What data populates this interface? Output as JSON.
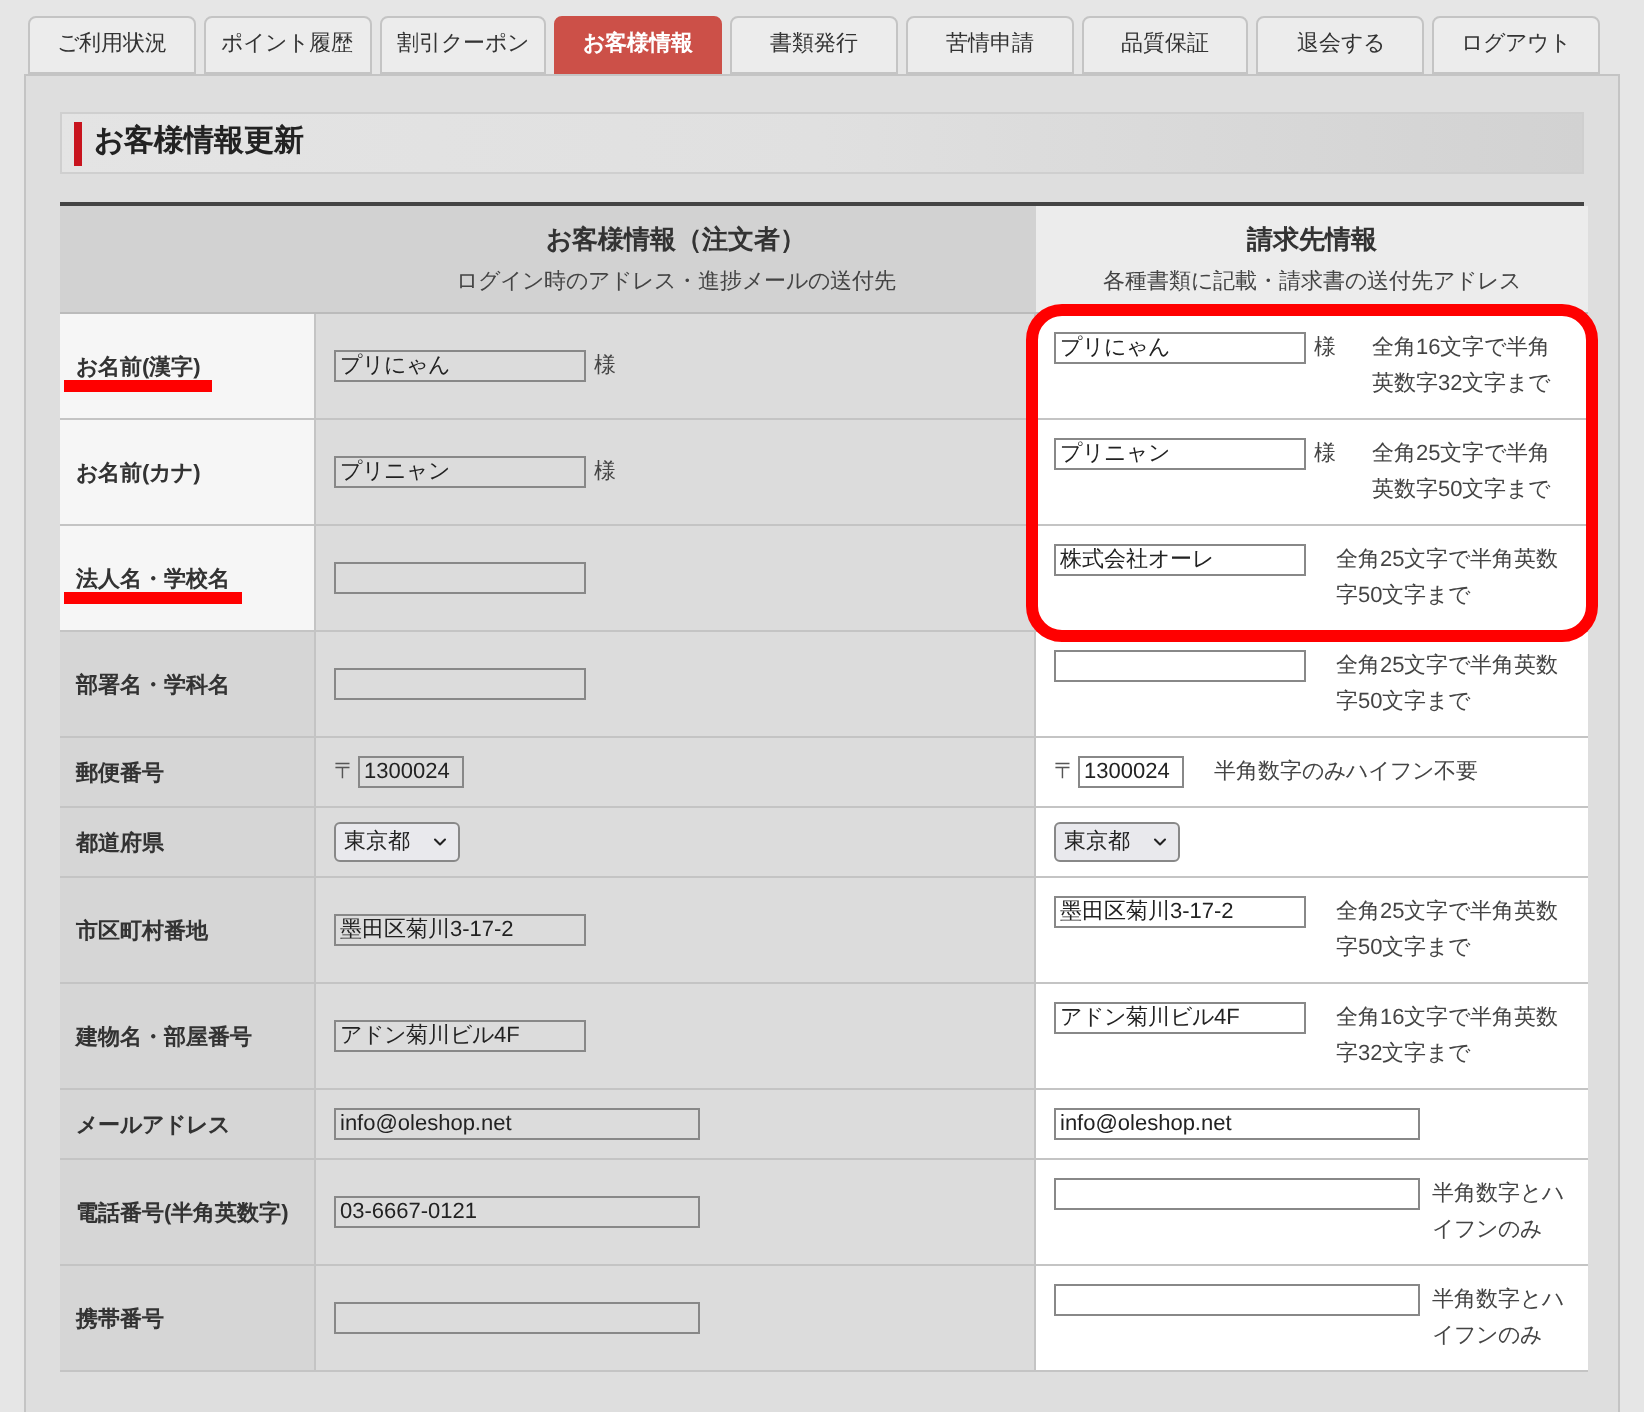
{
  "tabs": [
    {
      "label": "ご利用状況",
      "selected": false
    },
    {
      "label": "ポイント履歴",
      "selected": false
    },
    {
      "label": "割引クーポン",
      "selected": false
    },
    {
      "label": "お客様情報",
      "selected": true
    },
    {
      "label": "書類発行",
      "selected": false
    },
    {
      "label": "苦情申請",
      "selected": false
    },
    {
      "label": "品質保証",
      "selected": false
    },
    {
      "label": "退会する",
      "selected": false
    },
    {
      "label": "ログアウト",
      "selected": false
    }
  ],
  "section_title": "お客様情報更新",
  "header": {
    "customer_title": "お客様情報（注文者）",
    "customer_subtitle": "ログイン時のアドレス・進捗メールの送付先",
    "billing_title": "請求先情報",
    "billing_subtitle": "各種書類に記載・請求書の送付先アドレス"
  },
  "rows": [
    {
      "label": "お名前(漢字)",
      "underlined": true,
      "highlighted": true,
      "customer": {
        "kind": "field",
        "value": "プリにゃん",
        "suffix": "様"
      },
      "billing": {
        "kind": "field",
        "value": "プリにゃん",
        "suffix": "様",
        "note": "全角16文字で半角英数字32文字まで"
      }
    },
    {
      "label": "お名前(カナ)",
      "underlined": false,
      "highlighted": true,
      "customer": {
        "kind": "field",
        "value": "プリニャン",
        "suffix": "様"
      },
      "billing": {
        "kind": "field",
        "value": "プリニャン",
        "suffix": "様",
        "note": "全角25文字で半角英数字50文字まで"
      }
    },
    {
      "label": "法人名・学校名",
      "underlined": true,
      "highlighted": true,
      "customer": {
        "kind": "field"
      },
      "billing": {
        "kind": "field",
        "value": "株式会社オーレ",
        "note": "全角25文字で半角英数字50文字まで"
      }
    },
    {
      "label": "部署名・学科名",
      "underlined": false,
      "highlighted": false,
      "customer": {
        "kind": "field"
      },
      "billing": {
        "kind": "field",
        "note": "全角25文字で半角英数字50文字まで"
      }
    },
    {
      "label": "郵便番号",
      "underlined": false,
      "highlighted": false,
      "customer": {
        "kind": "postal",
        "prefix": "〒",
        "value": "1300024"
      },
      "billing": {
        "kind": "postal",
        "prefix": "〒",
        "value": "1300024",
        "note": "半角数字のみハイフン不要"
      }
    },
    {
      "label": "都道府県",
      "underlined": false,
      "highlighted": false,
      "customer": {
        "kind": "select",
        "value": "東京都"
      },
      "billing": {
        "kind": "select",
        "value": "東京都"
      }
    },
    {
      "label": "市区町村番地",
      "underlined": false,
      "highlighted": false,
      "customer": {
        "kind": "field",
        "value": "墨田区菊川3-17-2"
      },
      "billing": {
        "kind": "field",
        "value": "墨田区菊川3-17-2",
        "note": "全角25文字で半角英数字50文字まで"
      }
    },
    {
      "label": "建物名・部屋番号",
      "underlined": false,
      "highlighted": false,
      "customer": {
        "kind": "field",
        "value": "アドン菊川ビル4F"
      },
      "billing": {
        "kind": "field",
        "value": "アドン菊川ビル4F",
        "note": "全角16文字で半角英数字32文字まで"
      }
    },
    {
      "label": "メールアドレス",
      "underlined": false,
      "highlighted": false,
      "customer": {
        "kind": "widefield",
        "value": "info@oleshop.net"
      },
      "billing": {
        "kind": "widefield",
        "value": "info@oleshop.net"
      }
    },
    {
      "label": "電話番号(半角英数字)",
      "underlined": false,
      "highlighted": false,
      "customer": {
        "kind": "widefield",
        "value": "03-6667-0121"
      },
      "billing": {
        "kind": "widefield",
        "note": "半角数字とハイフンのみ"
      }
    },
    {
      "label": "携帯番号",
      "underlined": false,
      "highlighted": false,
      "customer": {
        "kind": "widefield"
      },
      "billing": {
        "kind": "widefield",
        "note": "半角数字とハイフンのみ"
      }
    }
  ]
}
